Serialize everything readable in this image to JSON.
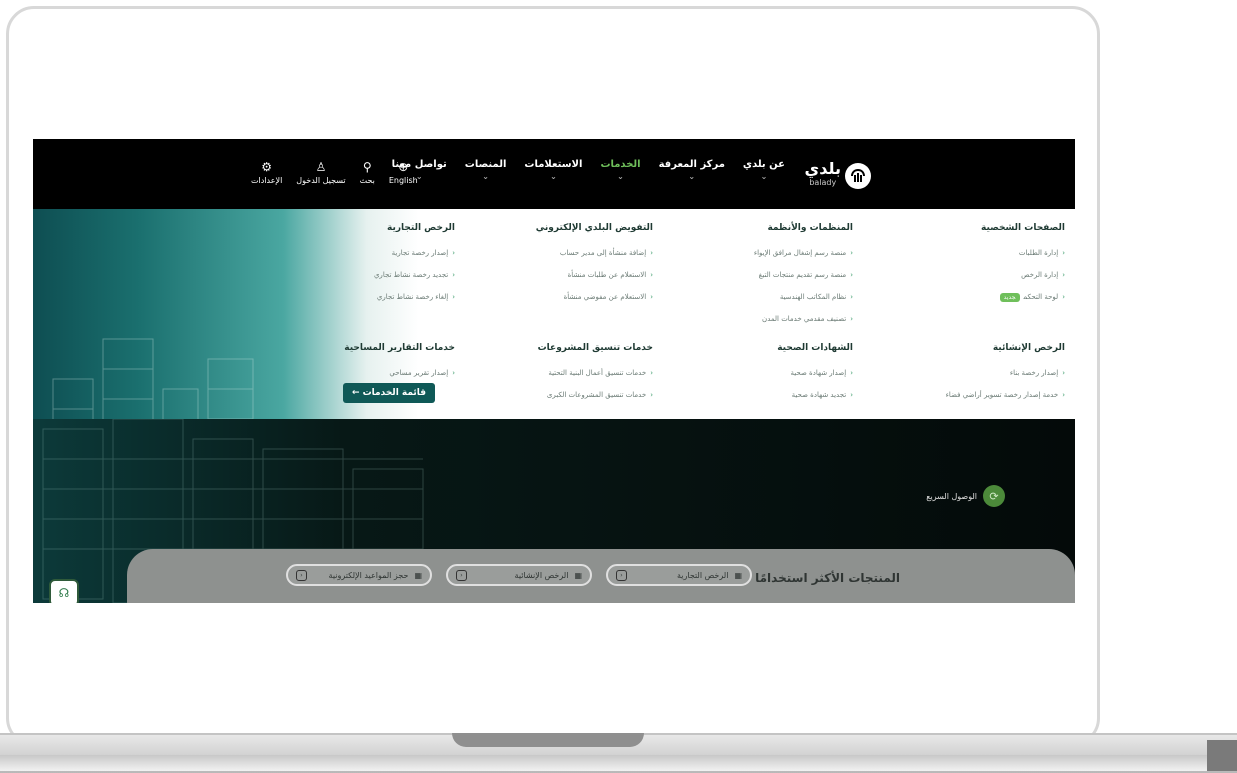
{
  "nav": {
    "logo_ar": "بلدي",
    "logo_en": "balady",
    "links": [
      {
        "label": "عن بلدي",
        "has_dropdown": true
      },
      {
        "label": "مركز المعرفة",
        "has_dropdown": true
      },
      {
        "label": "الخدمات",
        "has_dropdown": true,
        "active": true
      },
      {
        "label": "الاستعلامات",
        "has_dropdown": true
      },
      {
        "label": "المنصات",
        "has_dropdown": true
      },
      {
        "label": "تواصل معنا",
        "has_dropdown": true
      }
    ],
    "tools": [
      {
        "label": "English",
        "icon": "globe-icon"
      },
      {
        "label": "بحث",
        "icon": "search-icon"
      },
      {
        "label": "تسجيل الدخول",
        "icon": "user-icon"
      },
      {
        "label": "الإعدادات",
        "icon": "gear-icon"
      }
    ]
  },
  "menu": {
    "sections_row1": [
      {
        "title": "الصفحات الشخصية",
        "items": [
          "إدارة الطلبات",
          "إدارة الرخص",
          "لوحة التحكم"
        ],
        "badge_item_index": 2,
        "badge": "جديد"
      },
      {
        "title": "المنظمات والأنظمة",
        "items": [
          "منصة رسم إشغال مرافق الإيواء",
          "منصة رسم تقديم منتجات التبغ",
          "نظام المكاتب الهندسية",
          "تصنيف مقدمي خدمات المدن"
        ]
      },
      {
        "title": "التفويض البلدي الإلكتروني",
        "items": [
          "إضافة منشأة إلى مدير حساب",
          "الاستعلام عن طلبات منشأة",
          "الاستعلام عن مفوضي منشأة"
        ]
      },
      {
        "title": "الرخص التجارية",
        "items": [
          "إصدار رخصة تجارية",
          "تجديد رخصة نشاط تجاري",
          "إلغاء رخصة نشاط تجاري"
        ]
      }
    ],
    "sections_row2": [
      {
        "title": "الرخص الإنشائية",
        "items": [
          "إصدار رخصة بناء",
          "خدمة إصدار رخصة تسوير أراضي فضاء"
        ]
      },
      {
        "title": "الشهادات الصحية",
        "items": [
          "إصدار شهادة صحية",
          "تجديد شهادة صحية"
        ]
      },
      {
        "title": "خدمات تنسيق المشروعات",
        "items": [
          "خدمات تنسيق أعمال البنية التحتية",
          "خدمات تنسيق المشروعات الكبرى"
        ]
      },
      {
        "title": "خدمات التقارير المساحية",
        "items": [
          "إصدار تقرير مساحي"
        ]
      }
    ],
    "services_button": "قائمة الخدمات ←"
  },
  "quick_access": {
    "label": "الوصول السريع",
    "icon": "quick-access-icon"
  },
  "products": {
    "title": "المنتجات الأكثر استخدامًا",
    "pills": [
      "الرخص التجارية",
      "الرخص الإنشائية",
      "حجز المواعيد الإلكترونية"
    ]
  },
  "chat": {
    "icon": "support-chat-icon"
  }
}
